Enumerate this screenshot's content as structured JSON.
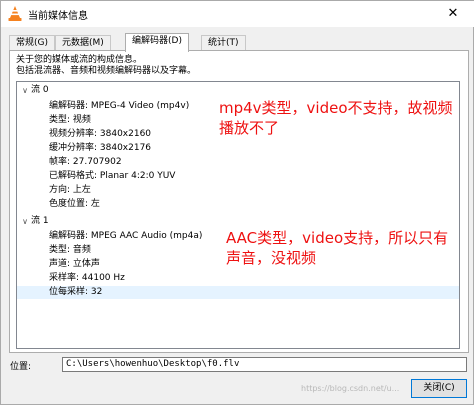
{
  "window": {
    "title": "当前媒体信息",
    "close_glyph": "✕"
  },
  "tabs": [
    {
      "label": "常规(G)"
    },
    {
      "label": "元数据(M)"
    },
    {
      "label": "编解码器(D)"
    },
    {
      "label": "统计(T)"
    }
  ],
  "active_tab": 2,
  "description": {
    "line1": "关于您的媒体或流的构成信息。",
    "line2": "包括混流器、音频和视频编解码器以及字幕。"
  },
  "streams": [
    {
      "label": "流 0",
      "expanded": true,
      "properties": [
        "编解码器: MPEG-4 Video (mp4v)",
        "类型: 视频",
        "视频分辨率: 3840x2160",
        "缓冲分辨率: 3840x2176",
        "帧率: 27.707902",
        "已解码格式: Planar 4:2:0 YUV",
        "方向: 上左",
        "色度位置: 左"
      ]
    },
    {
      "label": "流 1",
      "expanded": true,
      "properties": [
        "编解码器: MPEG AAC Audio (mp4a)",
        "类型: 音频",
        "声道: 立体声",
        "采样率: 44100 Hz",
        "位每采样: 32"
      ]
    }
  ],
  "annotations": {
    "video_line1": "mp4v类型，video不支持，故视频",
    "video_line2": "播放不了",
    "audio_line1": "AAC类型，video支持，所以只有",
    "audio_line2": "声音，没视频"
  },
  "location": {
    "label": "位置:",
    "value": "C:\\Users\\howenhuo\\Desktop\\f0.flv"
  },
  "buttons": {
    "close": "关闭(C)"
  },
  "watermark": "https://blog.csdn.net/u..."
}
